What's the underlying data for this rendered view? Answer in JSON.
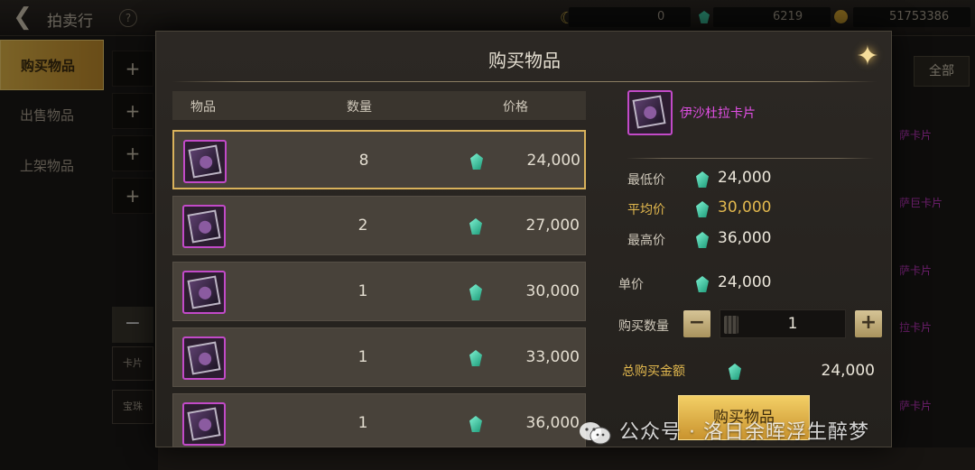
{
  "topbar": {
    "title": "拍卖行",
    "help": "?",
    "currencies": [
      "0",
      "6219",
      "51753386"
    ]
  },
  "side_tabs": [
    {
      "label": "购买物品",
      "active": true
    },
    {
      "label": "出售物品",
      "active": false
    },
    {
      "label": "上架物品",
      "active": false
    }
  ],
  "background": {
    "filter_all": "全部",
    "side_chips": [
      "卡片",
      "宝珠"
    ],
    "right_items": [
      "萨卡片",
      "萨巨卡片",
      "萨卡片",
      "拉卡片",
      "萨卡片"
    ]
  },
  "modal": {
    "title": "购买物品",
    "headers": {
      "item": "物品",
      "quantity": "数量",
      "price": "价格"
    },
    "rows": [
      {
        "quantity": "8",
        "price": "24,000",
        "selected": true
      },
      {
        "quantity": "2",
        "price": "27,000",
        "selected": false
      },
      {
        "quantity": "1",
        "price": "30,000",
        "selected": false
      },
      {
        "quantity": "1",
        "price": "33,000",
        "selected": false
      },
      {
        "quantity": "1",
        "price": "36,000",
        "selected": false
      }
    ],
    "detail": {
      "item_name": "伊沙杜拉卡片",
      "lowest_label": "最低价",
      "lowest_value": "24,000",
      "average_label": "平均价",
      "average_value": "30,000",
      "highest_label": "最高价",
      "highest_value": "36,000",
      "unit_label": "单价",
      "unit_value": "24,000",
      "qty_label": "购买数量",
      "qty_value": "1",
      "total_label": "总购买金额",
      "total_value": "24,000",
      "buy_label": "购买物品"
    }
  },
  "watermark": "公众号 · 洛日余晖浮生醉梦",
  "colors": {
    "accent_gold": "#e2b84e",
    "item_name": "#e24fe6",
    "gem": "#3cc7a0"
  }
}
